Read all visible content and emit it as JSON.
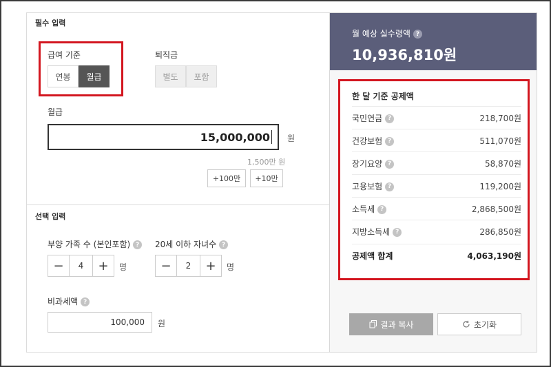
{
  "required_section": {
    "title": "필수 입력"
  },
  "pay_basis": {
    "label": "급여 기준",
    "options": [
      "연봉",
      "월급"
    ],
    "selected": "월급"
  },
  "severance": {
    "label": "퇴직금",
    "options": [
      "별도",
      "포함"
    ]
  },
  "monthly_salary": {
    "label": "월급",
    "value": "15,000,000",
    "unit": "원",
    "hint": "1,500만 원",
    "buttons": [
      "+100만",
      "+10만"
    ]
  },
  "optional_section": {
    "title": "선택 입력"
  },
  "dependents": {
    "label": "부양 가족 수 (본인포함)",
    "value": "4",
    "unit": "명"
  },
  "children": {
    "label": "20세 이하 자녀수",
    "value": "2",
    "unit": "명"
  },
  "nontaxable": {
    "label": "비과세액",
    "value": "100,000",
    "unit": "원"
  },
  "result": {
    "label": "월 예상 실수령액",
    "amount": "10,936,810원",
    "deduction_title": "한 달 기준 공제액",
    "rows": [
      {
        "name": "국민연금",
        "value": "218,700원"
      },
      {
        "name": "건강보험",
        "value": "511,070원"
      },
      {
        "name": "장기요양",
        "value": "58,870원"
      },
      {
        "name": "고용보험",
        "value": "119,200원"
      },
      {
        "name": "소득세",
        "value": "2,868,500원"
      },
      {
        "name": "지방소득세",
        "value": "286,850원"
      }
    ],
    "total": {
      "name": "공제액 합계",
      "value": "4,063,190원"
    }
  },
  "actions": {
    "copy": "결과 복사",
    "reset": "초기화"
  },
  "icons": {
    "help": "question-mark-icon",
    "copy": "copy-icon",
    "reset": "refresh-icon"
  },
  "colors": {
    "header_bg": "#5b5e7a",
    "highlight_red": "#d3161f",
    "active_segment": "#555555",
    "copy_button": "#a8a8a8"
  }
}
